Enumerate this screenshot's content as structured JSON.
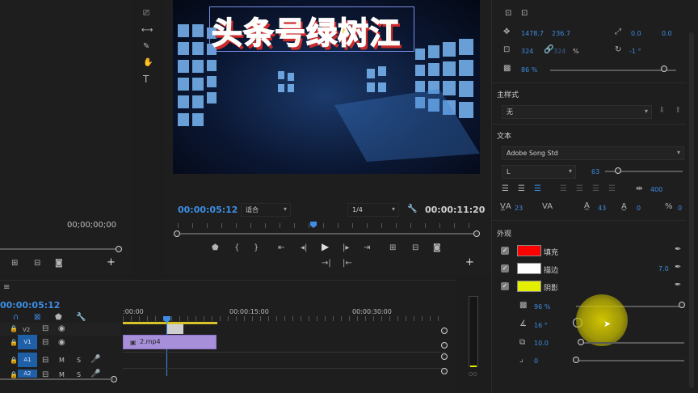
{
  "source": {
    "timecode": "00;00;00;00",
    "icons": [
      "insert-icon",
      "overwrite-icon",
      "export-frame-icon",
      "add-icon"
    ]
  },
  "program": {
    "title_text": "头条号绿树江",
    "current_time": "00:00:05:12",
    "fit_label": "适合",
    "resolution": "1/4",
    "duration": "00:00:11:20",
    "colors": {
      "title_fill": "#e8d233",
      "title_stroke": "#ffffff",
      "title_shadow": "#cc2b2b",
      "accent": "#3d8de4"
    }
  },
  "tools": [
    "range-icon",
    "ripple-icon",
    "pen-icon",
    "hand-icon",
    "type-icon"
  ],
  "timeline": {
    "current_time": "00:00:05:12",
    "ruler": [
      ":00:00",
      "00:00:15:00",
      "00:00:30:00"
    ],
    "tracks": [
      {
        "id": "V2",
        "buttons": [
          "V2"
        ]
      },
      {
        "id": "V1",
        "buttons": [
          "V1"
        ]
      },
      {
        "id": "A1",
        "m": "M",
        "s": "S"
      },
      {
        "id": "A2",
        "m": "M",
        "s": "S"
      }
    ],
    "clip_name": "2.mp4"
  },
  "effects": {
    "position": {
      "x": "1478.7",
      "y": "236.7"
    },
    "anchor": {
      "x": "0.0",
      "y": "0.0"
    },
    "scale": {
      "w": "324",
      "h": "324",
      "unit": "%"
    },
    "rotation": "-1 °",
    "opacity": "86 %",
    "master_style_label": "主样式",
    "master_style_value": "无",
    "text_label": "文本",
    "font": "Adobe Song Std",
    "font_style": "L",
    "font_size": "63",
    "tracking": "400",
    "kerning": "23",
    "leading": "43",
    "baseline": "0",
    "tsume": "0",
    "appearance_label": "外观",
    "fill": {
      "label": "填充",
      "color": "#ff0000"
    },
    "stroke": {
      "label": "描边",
      "color": "#ffffff",
      "width": "7.0"
    },
    "shadow": {
      "label": "阴影",
      "color": "#e4ef00"
    },
    "shadow_opacity": "96 %",
    "shadow_angle": "16 °",
    "shadow_distance": "10.0",
    "shadow_size": "0"
  }
}
